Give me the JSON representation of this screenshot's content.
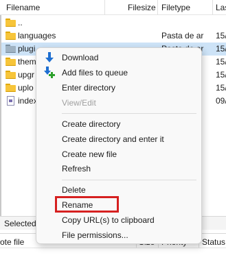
{
  "columns": {
    "filename": "Filename",
    "filesize": "Filesize",
    "filetype": "Filetype",
    "modified": "Las"
  },
  "files": [
    {
      "name": "..",
      "type": "",
      "modified": "",
      "icon": "folder-icon"
    },
    {
      "name": "languages",
      "type": "Pasta de ar...",
      "modified": "15/",
      "icon": "folder-icon"
    },
    {
      "name": "plugins",
      "type": "Pasta de ar...",
      "modified": "15/",
      "icon": "folder-icon"
    },
    {
      "name": "themes",
      "type": "",
      "modified": "15/",
      "icon": "folder-icon"
    },
    {
      "name": "upgrade",
      "type": "",
      "modified": "15/",
      "icon": "folder-icon"
    },
    {
      "name": "uploads",
      "type": "",
      "modified": "15/",
      "icon": "folder-icon"
    },
    {
      "name": "index.php",
      "type": "",
      "modified": "09/",
      "icon": "php-file-icon"
    }
  ],
  "visible_names": [
    "..",
    "languages",
    "plugi",
    "them",
    "upgr",
    "uplo",
    "index"
  ],
  "visible_types": [
    "",
    "Pasta de ar",
    "Pasta de ar",
    "",
    "",
    "",
    ""
  ],
  "status_bar": {
    "text": "Selected"
  },
  "queue_columns": {
    "file": "ote file",
    "size": "Size",
    "priority": "Priority",
    "status": "Status"
  },
  "context_menu": {
    "items": [
      {
        "label": "Download",
        "icon": "download-icon",
        "enabled": true
      },
      {
        "label": "Add files to queue",
        "icon": "add-to-queue-icon",
        "enabled": true
      },
      {
        "label": "Enter directory",
        "enabled": true
      },
      {
        "label": "View/Edit",
        "enabled": false
      },
      {
        "label": "Create directory",
        "enabled": true
      },
      {
        "label": "Create directory and enter it",
        "enabled": true
      },
      {
        "label": "Create new file",
        "enabled": true
      },
      {
        "label": "Refresh",
        "enabled": true
      },
      {
        "label": "Delete",
        "enabled": true
      },
      {
        "label": "Rename",
        "enabled": true,
        "highlighted": true
      },
      {
        "label": "Copy URL(s) to clipboard",
        "enabled": true
      },
      {
        "label": "File permissions...",
        "enabled": true
      }
    ],
    "highlight_color": "#d62020"
  },
  "colors": {
    "selection": "#cde3f7",
    "folder": "#f7c53a",
    "accent_blue": "#1f6fd1",
    "accent_green": "#2ca02c"
  }
}
